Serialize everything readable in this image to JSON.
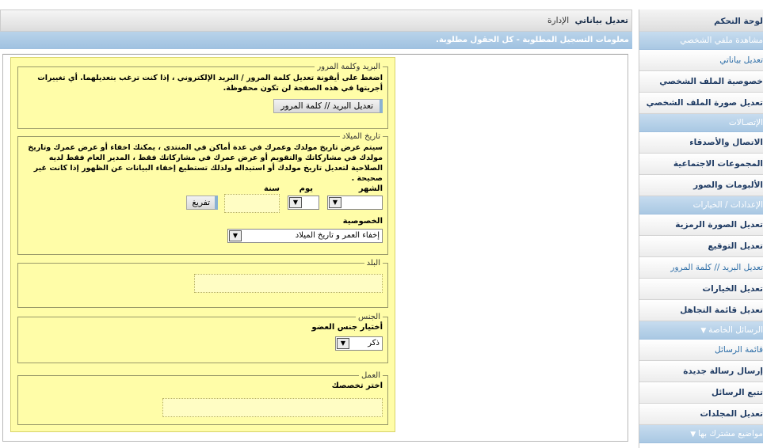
{
  "sidebar": {
    "items": [
      {
        "label": "لوحة التحكم",
        "kind": "cp"
      },
      {
        "label": "مشاهدة ملفي الشخصي",
        "kind": "head"
      },
      {
        "label": "تعديل بياناتي",
        "kind": "active"
      },
      {
        "label": "خصوصية الملف الشخصي",
        "kind": "item"
      },
      {
        "label": "تعديل صورة الملف الشخصي",
        "kind": "item"
      },
      {
        "label": "الإتصـالات",
        "kind": "head"
      },
      {
        "label": "الاتصال والأصدقاء",
        "kind": "item"
      },
      {
        "label": "المجموعات الاجتماعية",
        "kind": "item"
      },
      {
        "label": "الألبومات والصور",
        "kind": "item"
      },
      {
        "label": "الإعدادات / الخيارات",
        "kind": "head"
      },
      {
        "label": "تعديل الصورة الرمزية",
        "kind": "item"
      },
      {
        "label": "تعديل التوقيع",
        "kind": "item"
      },
      {
        "label": "تعديل البريد // كلمة المرور",
        "kind": "active"
      },
      {
        "label": "تعديل الخيارات",
        "kind": "item"
      },
      {
        "label": "تعديل قائمة التجاهل",
        "kind": "item"
      },
      {
        "label": "الرسائل الخاصة",
        "kind": "head-arrow"
      },
      {
        "label": "قائمة الرسائل",
        "kind": "active"
      },
      {
        "label": "إرسال رسالة جديدة",
        "kind": "item"
      },
      {
        "label": "تتبع الرسائل",
        "kind": "item"
      },
      {
        "label": "تعديل المجلدات",
        "kind": "item"
      },
      {
        "label": "مواضيع مشترك بها",
        "kind": "head-arrow"
      }
    ]
  },
  "header": {
    "title": "تعديل بياناتي",
    "breadcrumb": "الإدارة",
    "info": "معلومات التسجيل المطلوبة - كل الحقول مطلوبة."
  },
  "email_section": {
    "legend": "البريد وكلمة المرور",
    "text": "اضغط على أيقونة تعديل كلمة المرور / البريد الإلكتروني ، إذا كنت ترغب بتعديلهما. أي تغييرات أجريتها في هذه الصفحة لن تكون محفوظة.",
    "button": "تعديل البريد // كلمة المرور"
  },
  "birthday_section": {
    "legend": "تاريخ الميلاد",
    "text": "سيتم عرض تاريخ مولدك وعمرك في عدة أماكن في المنتدى ، يمكنك اخفاء أو عرض عمرك وتاريخ مولدك في مشاركاتك والتقويم أو عرض عمرك في مشاركاتك فقط ، المدير العام فقط لديه الصلاحية لتعديل تاريخ مولدك أو استبداله ولذلك تستطيع إخفاء البيانات عن الظهور إذا كانت غير صحيحة .",
    "month_label": "الشهر",
    "day_label": "يوم",
    "year_label": "سنة",
    "month_value": "",
    "day_value": "",
    "year_value": "",
    "clear_button": "تفريغ",
    "privacy_label": "الخصوصية",
    "privacy_value": "إخفاء العمر و تاريخ الميلاد"
  },
  "country_section": {
    "legend": "البلد",
    "value": ""
  },
  "gender_section": {
    "legend": "الجنس",
    "label": "أختيار جنس العضو",
    "value": "ذكر"
  },
  "work_section": {
    "legend": "العمل",
    "label": "اختر تخصصك",
    "value": ""
  },
  "icons": {
    "dropdown": "chevron-down-icon",
    "section_toggle": "triangle-down-icon"
  },
  "colors": {
    "accent": "#a9c8e3",
    "form_bg": "#fffda8",
    "link": "#2f6fa8"
  }
}
